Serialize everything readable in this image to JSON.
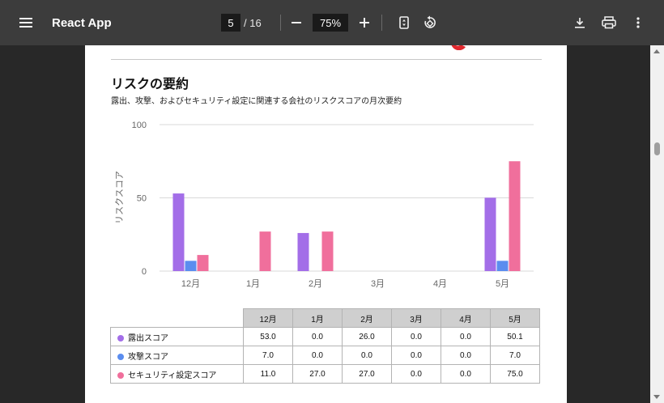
{
  "toolbar": {
    "app_title": "React App",
    "current_page": "5",
    "total_pages": "/ 16",
    "zoom": "75%"
  },
  "section": {
    "title": "リスクの要約",
    "subtitle": "露出、攻撃、およびセキュリティ設定に関連する会社のリスクスコアの月次要約"
  },
  "colors": {
    "exposure": "#a36ee8",
    "attack": "#5b8def",
    "security": "#f06f9c",
    "brand": "#e0282e"
  },
  "chart_data": {
    "type": "bar",
    "categories": [
      "12月",
      "1月",
      "2月",
      "3月",
      "4月",
      "5月"
    ],
    "ylabel": "リスクスコア",
    "ylim": [
      0,
      100
    ],
    "yticks": [
      0,
      50,
      100
    ],
    "grid": true,
    "series": [
      {
        "name": "露出スコア",
        "values": [
          53.0,
          0.0,
          26.0,
          0.0,
          0.0,
          50.1
        ]
      },
      {
        "name": "攻撃スコア",
        "values": [
          7.0,
          0.0,
          0.0,
          0.0,
          0.0,
          7.0
        ]
      },
      {
        "name": "セキュリティ設定スコア",
        "values": [
          11.0,
          27.0,
          27.0,
          0.0,
          0.0,
          75.0
        ]
      }
    ]
  },
  "table": {
    "headers": [
      "12月",
      "1月",
      "2月",
      "3月",
      "4月",
      "5月"
    ],
    "rows": [
      {
        "label": "露出スコア",
        "values": [
          "53.0",
          "0.0",
          "26.0",
          "0.0",
          "0.0",
          "50.1"
        ]
      },
      {
        "label": "攻撃スコア",
        "values": [
          "7.0",
          "0.0",
          "0.0",
          "0.0",
          "0.0",
          "7.0"
        ]
      },
      {
        "label": "セキュリティ設定スコア",
        "values": [
          "11.0",
          "27.0",
          "27.0",
          "0.0",
          "0.0",
          "75.0"
        ]
      }
    ]
  }
}
